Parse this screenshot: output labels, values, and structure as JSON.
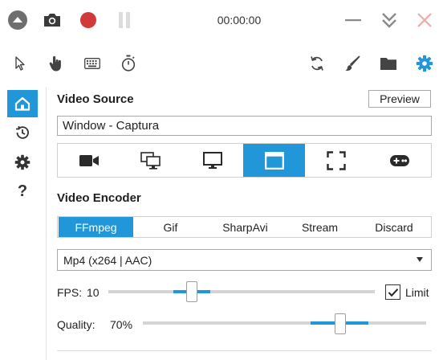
{
  "titlebar": {
    "timer": "00:00:00",
    "icons": [
      "collapse-up-icon",
      "camera-icon",
      "record-icon",
      "pause-icon",
      "minimize-icon",
      "tray-down-icon",
      "close-icon"
    ],
    "record_color": "#d23a3a"
  },
  "toolbar": {
    "icons": [
      "mouse-pointer-icon",
      "hand-click-icon",
      "keyboard-icon",
      "stopwatch-icon",
      "refresh-icon",
      "brush-icon",
      "folder-icon",
      "settings-gear-icon"
    ],
    "accent": "#2196d8"
  },
  "sidebar": {
    "items": [
      "home-icon",
      "history-icon",
      "settings-icon"
    ],
    "help_label": "?"
  },
  "video_source": {
    "heading": "Video Source",
    "preview_label": "Preview",
    "source_value": "Window  -  Captura",
    "sources": [
      "webcam-icon",
      "multi-screen-icon",
      "monitor-icon",
      "window-icon",
      "region-icon",
      "gamepad-icon"
    ],
    "active_source": "window-icon"
  },
  "video_encoder": {
    "heading": "Video Encoder",
    "tabs": [
      "FFmpeg",
      "Gif",
      "SharpAvi",
      "Stream",
      "Discard"
    ],
    "active_tab": "FFmpeg",
    "format": "Mp4 (x264 | AAC)"
  },
  "fps": {
    "label": "FPS:",
    "value": "10",
    "limit_label": "Limit",
    "limit_checked": true
  },
  "quality": {
    "label": "Quality:",
    "value": "70%",
    "level": 0.7
  }
}
